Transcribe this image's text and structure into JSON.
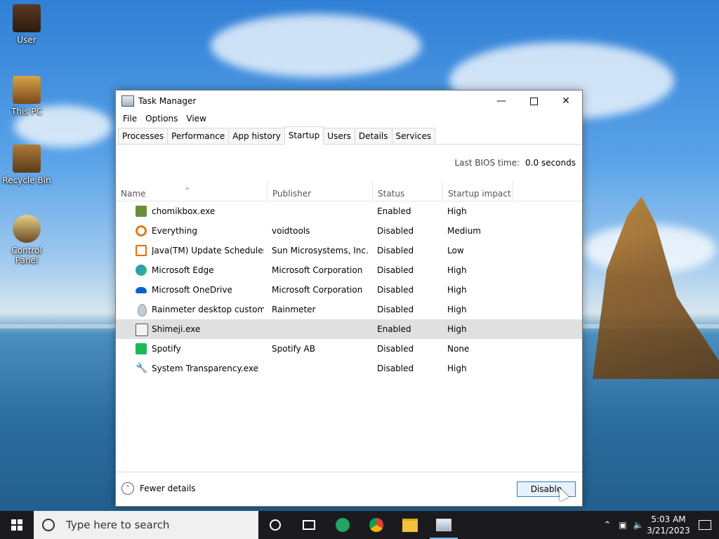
{
  "desktop": {
    "icons": [
      {
        "label": "User"
      },
      {
        "label": "This PC"
      },
      {
        "label": "Recycle Bin"
      },
      {
        "label": "Control Panel"
      }
    ]
  },
  "window": {
    "title": "Task Manager",
    "menu": [
      "File",
      "Options",
      "View"
    ],
    "tabs": [
      "Processes",
      "Performance",
      "App history",
      "Startup",
      "Users",
      "Details",
      "Services"
    ],
    "active_tab": "Startup",
    "bios_label": "Last BIOS time:",
    "bios_value": "0.0 seconds",
    "columns": [
      "Name",
      "Publisher",
      "Status",
      "Startup impact"
    ],
    "rows": [
      {
        "name": "chomikbox.exe",
        "publisher": "",
        "status": "Enabled",
        "impact": "High",
        "icon": "chomikbox-icon",
        "color": "#6b8e3a"
      },
      {
        "name": "Everything",
        "publisher": "voidtools",
        "status": "Disabled",
        "impact": "Medium",
        "icon": "magnifier-icon",
        "color": "#e07a1f"
      },
      {
        "name": "Java(TM) Update Scheduler",
        "publisher": "Sun Microsystems, Inc.",
        "status": "Disabled",
        "impact": "Low",
        "icon": "java-icon",
        "color": "#e76f00"
      },
      {
        "name": "Microsoft Edge",
        "publisher": "Microsoft Corporation",
        "status": "Disabled",
        "impact": "High",
        "icon": "edge-icon",
        "color": "#1f8fd8"
      },
      {
        "name": "Microsoft OneDrive",
        "publisher": "Microsoft Corporation",
        "status": "Disabled",
        "impact": "High",
        "icon": "onedrive-icon",
        "color": "#0a64c8"
      },
      {
        "name": "Rainmeter desktop customi...",
        "publisher": "Rainmeter",
        "status": "Disabled",
        "impact": "High",
        "icon": "rainmeter-drop-icon",
        "color": "#9aa6b2"
      },
      {
        "name": "Shimeji.exe",
        "publisher": "",
        "status": "Enabled",
        "impact": "High",
        "icon": "shimeji-icon",
        "color": "#8c8c8c"
      },
      {
        "name": "Spotify",
        "publisher": "Spotify AB",
        "status": "Disabled",
        "impact": "None",
        "icon": "spotify-icon",
        "color": "#1db954"
      },
      {
        "name": "System Transparency.exe",
        "publisher": "",
        "status": "Disabled",
        "impact": "High",
        "icon": "wrench-icon",
        "color": "#333333"
      }
    ],
    "selected_row": 6,
    "fewer_details": "Fewer details",
    "disable_button": "Disable"
  },
  "taskbar": {
    "search_placeholder": "Type here to search",
    "time": "5:03 AM",
    "date": "3/21/2023"
  },
  "colors": {
    "accent": "#76b9ed",
    "selected_row": "#e0e0e0",
    "button_border": "#3c7fb1"
  }
}
